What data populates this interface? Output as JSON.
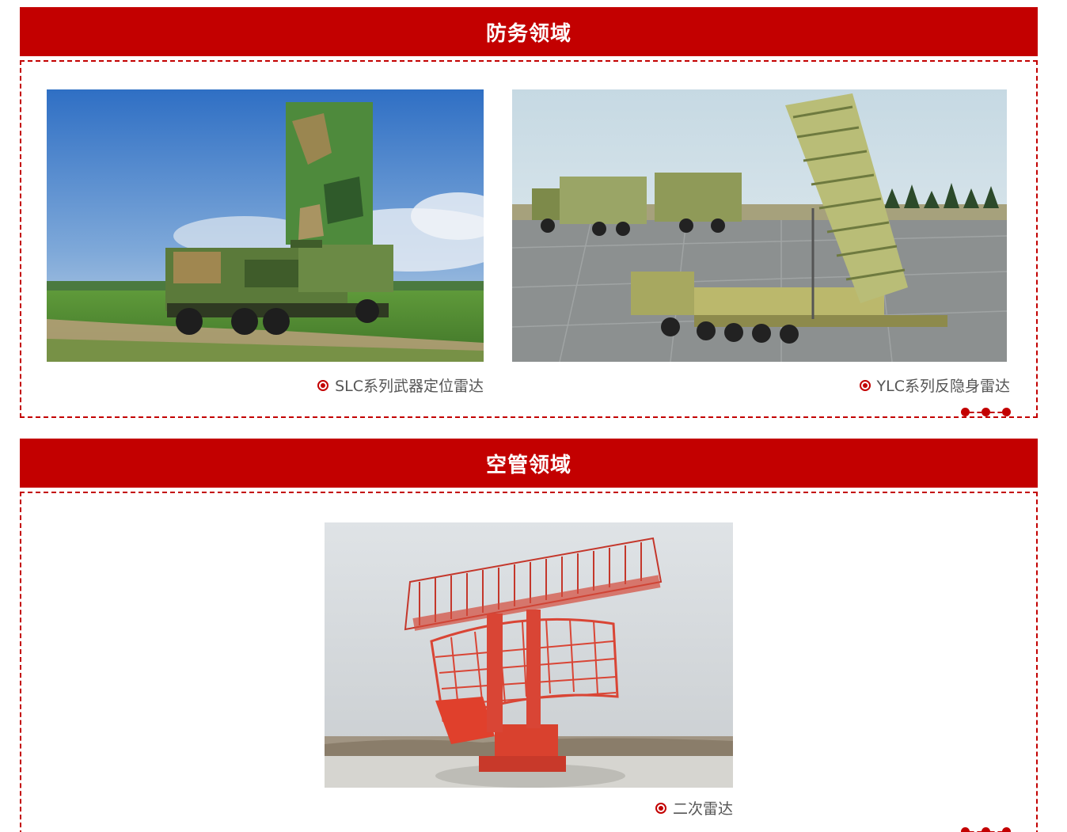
{
  "sections": [
    {
      "title": "防务领域",
      "items": [
        {
          "caption": "SLC系列武器定位雷达"
        },
        {
          "caption": "YLC系列反隐身雷达"
        }
      ]
    },
    {
      "title": "空管领域",
      "items": [
        {
          "caption": "二次雷达"
        }
      ]
    }
  ],
  "colors": {
    "accent": "#c30000"
  },
  "icons": {
    "caption_bullet": "radio-bullet-icon",
    "decoration": "three-dots-icon"
  }
}
